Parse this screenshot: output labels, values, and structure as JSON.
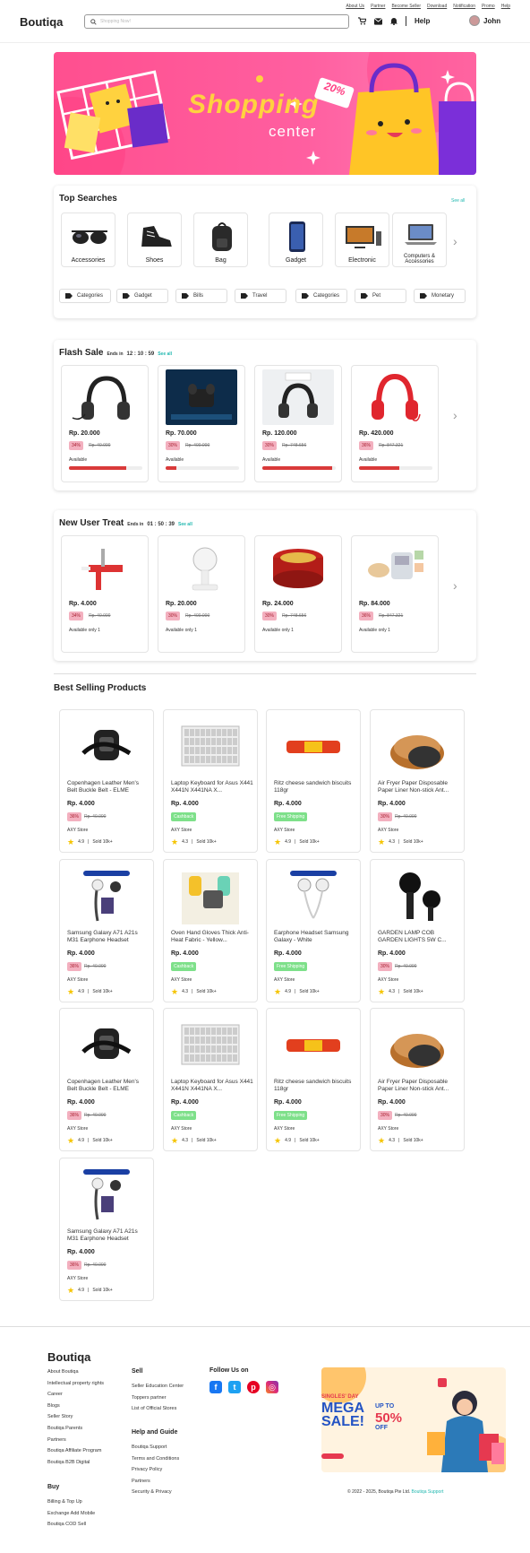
{
  "topnav": [
    "About Us",
    "Partner",
    "Become Seller",
    "Download",
    "Notification",
    "Promo",
    "Help"
  ],
  "header": {
    "logo": "Boutiqa",
    "search_placeholder": "Shopping Now!",
    "help": "Help",
    "user": "John"
  },
  "banner": {
    "title": "Shopping",
    "subtitle": "center",
    "tag": "20%"
  },
  "top_searches": {
    "title": "Top Searches",
    "see_all": "See all",
    "categories": [
      "Accessories",
      "Shoes",
      "Bag",
      "Gadget",
      "Electronic",
      "Computers & Accessories"
    ],
    "chips": [
      "Categories",
      "Gadget",
      "Bills",
      "Travel",
      "Categories",
      "Pet",
      "Monetary"
    ]
  },
  "flash_sale": {
    "title": "Flash Sale",
    "ends": "Ends in",
    "timer": "12 : 10 : 59",
    "see_all": "See all",
    "items": [
      {
        "price": "Rp. 20.000",
        "disc": "34%",
        "old": "Rp. 40.000",
        "avail": "Available",
        "fill": 0.78
      },
      {
        "price": "Rp. 70.000",
        "disc": "30%",
        "old": "Rp. 400.000",
        "avail": "Available",
        "fill": 0.15
      },
      {
        "price": "Rp. 120.000",
        "disc": "30%",
        "old": "Rp. 748.656",
        "avail": "Available",
        "fill": 0.95
      },
      {
        "price": "Rp. 420.000",
        "disc": "36%",
        "old": "Rp. 847.321",
        "avail": "Available",
        "fill": 0.55
      }
    ]
  },
  "new_user": {
    "title": "New User Treat",
    "ends": "Ends in",
    "timer": "01 : 50 : 39",
    "see_all": "See all",
    "items": [
      {
        "price": "Rp. 4.000",
        "disc": "34%",
        "old": "Rp. 40.000",
        "avail": "Available only 1"
      },
      {
        "price": "Rp. 20.000",
        "disc": "30%",
        "old": "Rp. 400.000",
        "avail": "Available only 1"
      },
      {
        "price": "Rp. 24.000",
        "disc": "30%",
        "old": "Rp. 748.656",
        "avail": "Available only 1"
      },
      {
        "price": "Rp. 84.000",
        "disc": "36%",
        "old": "Rp. 847.321",
        "avail": "Available only 1"
      }
    ]
  },
  "best_selling": {
    "title": "Best Selling Products",
    "items": [
      {
        "name": "Copenhagen Leather Men's Belt Buckle Belt - ELME",
        "price": "Rp. 4.000",
        "badge": "36%",
        "old": "Rp. 40.000",
        "store": "AXY Store",
        "rating": "4.9",
        "sold": "Sold 10k+"
      },
      {
        "name": "Laptop Keyboard for Asus X441 X441N X441NA X...",
        "price": "Rp. 4.000",
        "badge": "Cashback",
        "old": "",
        "store": "AXY Store",
        "rating": "4.3",
        "sold": "Sold 10k+"
      },
      {
        "name": "Ritz cheese sandwich biscuits 118gr",
        "price": "Rp. 4.000",
        "badge": "Free Shipping",
        "old": "",
        "store": "AXY Store",
        "rating": "4.9",
        "sold": "Sold 10k+"
      },
      {
        "name": "Air Fryer Paper Disposable Paper Liner Non-stick Ant...",
        "price": "Rp. 4.000",
        "badge": "30%",
        "old": "Rp. 40.000",
        "store": "AXY Store",
        "rating": "4.3",
        "sold": "Sold 10k+"
      },
      {
        "name": "Samsung Galaxy A71 A21s M31 Earphone Headset",
        "price": "Rp. 4.000",
        "badge": "36%",
        "old": "Rp. 40.000",
        "store": "AXY Store",
        "rating": "4.9",
        "sold": "Sold 10k+"
      },
      {
        "name": "Oven Hand Gloves Thick Anti-Heat Fabric - Yellow...",
        "price": "Rp. 4.000",
        "badge": "Cashback",
        "old": "",
        "store": "AXY Store",
        "rating": "4.3",
        "sold": "Sold 10k+"
      },
      {
        "name": "Earphone Headset Samsung Galaxy - White",
        "price": "Rp. 4.000",
        "badge": "Free Shipping",
        "old": "",
        "store": "AXY Store",
        "rating": "4.9",
        "sold": "Sold 10k+"
      },
      {
        "name": "GARDEN LAMP COB GARDEN LIGHTS 5W C...",
        "price": "Rp. 4.000",
        "badge": "30%",
        "old": "Rp. 40.000",
        "store": "AXY Store",
        "rating": "4.3",
        "sold": "Sold 10k+"
      },
      {
        "name": "Copenhagen Leather Men's Belt Buckle Belt - ELME",
        "price": "Rp. 4.000",
        "badge": "36%",
        "old": "Rp. 40.000",
        "store": "AXY Store",
        "rating": "4.9",
        "sold": "Sold 10k+"
      },
      {
        "name": "Laptop Keyboard for Asus X441 X441N X441NA X...",
        "price": "Rp. 4.000",
        "badge": "Cashback",
        "old": "",
        "store": "AXY Store",
        "rating": "4.3",
        "sold": "Sold 10k+"
      },
      {
        "name": "Ritz cheese sandwich biscuits 118gr",
        "price": "Rp. 4.000",
        "badge": "Free Shipping",
        "old": "",
        "store": "AXY Store",
        "rating": "4.9",
        "sold": "Sold 10k+"
      },
      {
        "name": "Air Fryer Paper Disposable Paper Liner Non-stick Ant...",
        "price": "Rp. 4.000",
        "badge": "30%",
        "old": "Rp. 40.000",
        "store": "AXY Store",
        "rating": "4.3",
        "sold": "Sold 10k+"
      },
      {
        "name": "Samsung Galaxy A71 A21s M31 Earphone Headset",
        "price": "Rp. 4.000",
        "badge": "36%",
        "old": "Rp. 40.000",
        "store": "AXY Store",
        "rating": "4.9",
        "sold": "Sold 10k+"
      }
    ]
  },
  "footer": {
    "logo": "Boutiqa",
    "about_links": [
      "About Boutiqa",
      "Intellectual property rights",
      "Career",
      "Blogs",
      "Seller Story",
      "Boutiqa Parents",
      "Partners",
      "Boutiqa Affiliate Program",
      "Boutiqa B2B Digital"
    ],
    "buy_title": "Buy",
    "buy_links": [
      "Billing & Top Up",
      "Exchange Add Mobile",
      "Boutiqa COD Sell"
    ],
    "sell_title": "Sell",
    "sell_links": [
      "Seller Education Center",
      "Toppers partner",
      "List of Official Stores"
    ],
    "help_title": "Help and Guide",
    "help_links": [
      "Boutiqa Support",
      "Terms and Conditions",
      "Privacy Policy",
      "Partners",
      "Security & Privacy"
    ],
    "follow": "Follow Us on",
    "promo": {
      "kicker": "SINGLES' DAY",
      "mega": "MEGA",
      "sale": "SALE!",
      "upto": "UP TO",
      "pct": "50%",
      "off": "OFF"
    },
    "copyright": "2022 - 2025, Boutiqa Pte Ltd.",
    "copyright_link": "Boutiqa Support"
  }
}
